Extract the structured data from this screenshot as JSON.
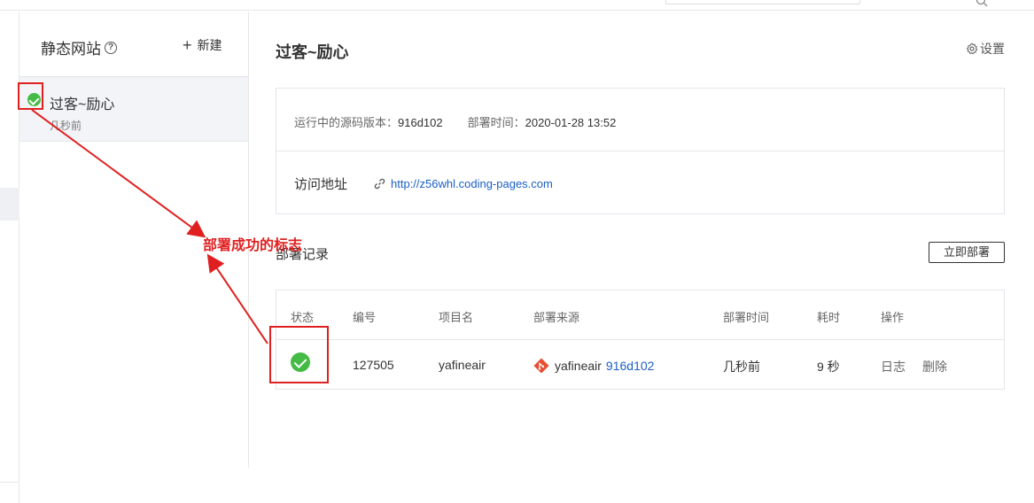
{
  "sidebar": {
    "title": "静态网站",
    "new_label": "新建",
    "sites": [
      {
        "name": "过客~励心",
        "time": "几秒前",
        "status": "success"
      }
    ]
  },
  "main": {
    "title": "过客~励心",
    "settings_label": "设置",
    "info": {
      "source_version_label": "运行中的源码版本：",
      "source_version": "916d102",
      "deploy_time_label": "部署时间：",
      "deploy_time": "2020-01-28 13:52",
      "access_label": "访问地址",
      "url": "http://z56whl.coding-pages.com"
    },
    "records": {
      "title": "部署记录",
      "deploy_now_label": "立即部署",
      "columns": [
        "状态",
        "编号",
        "项目名",
        "部署来源",
        "部署时间",
        "耗时",
        "操作"
      ],
      "rows": [
        {
          "status": "success",
          "id": "127505",
          "project": "yafineair",
          "source_repo": "yafineair",
          "source_commit": "916d102",
          "deploy_time": "几秒前",
          "duration": "9 秒",
          "action_log": "日志",
          "action_delete": "删除"
        }
      ]
    }
  },
  "annotation": {
    "text": "部署成功的标志",
    "color": "#e02020"
  },
  "colors": {
    "success": "#44bb44",
    "link": "#1b5fc7",
    "git": "#e84d31",
    "border": "#e3e5ea"
  }
}
